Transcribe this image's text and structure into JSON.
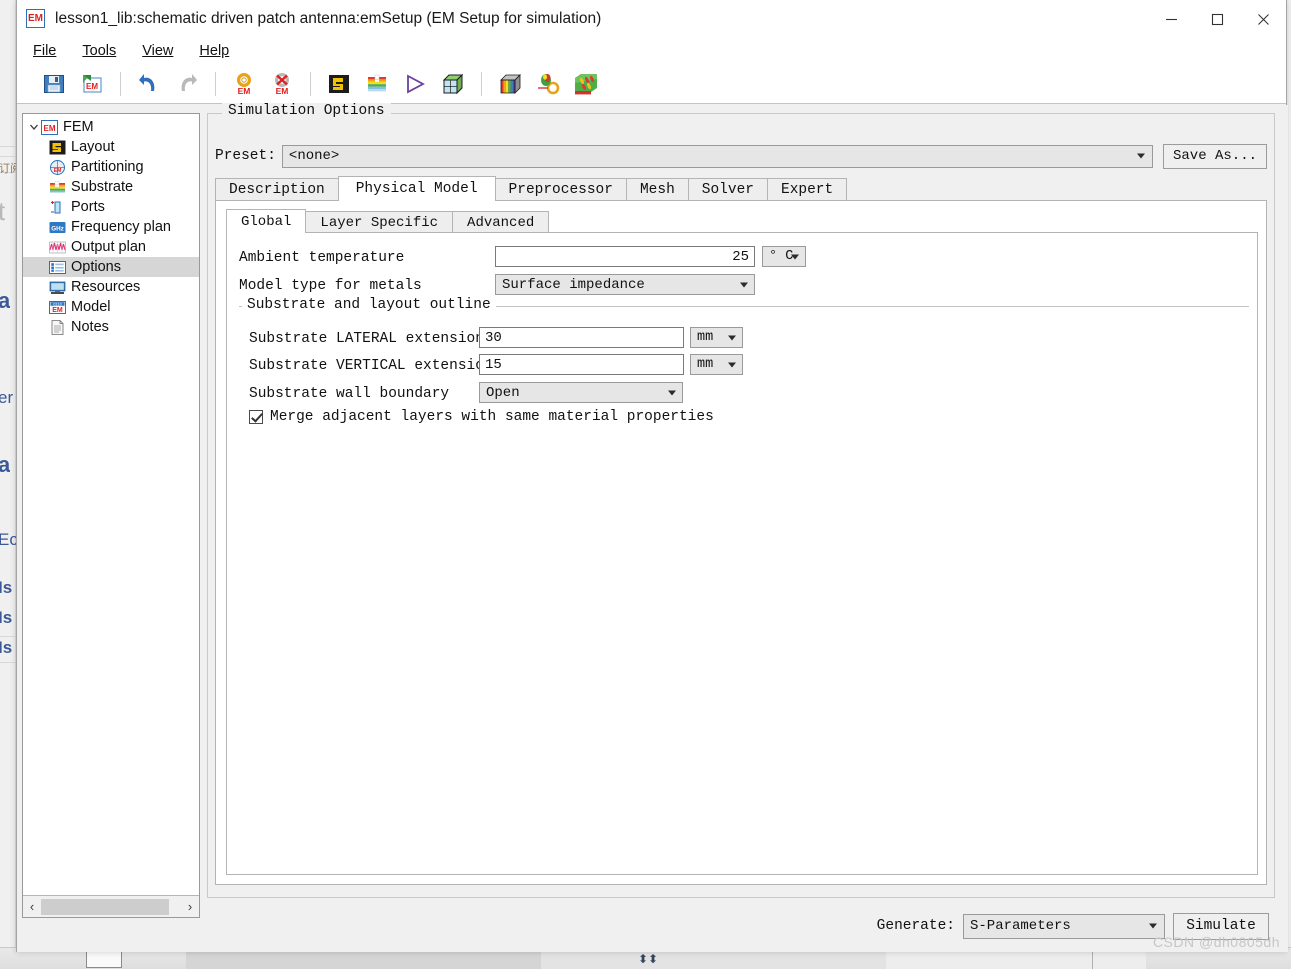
{
  "window": {
    "title": "lesson1_lib:schematic driven patch antenna:emSetup (EM Setup for simulation)",
    "app_icon_text": "EM",
    "minimize_label": "—",
    "maximize_label": "□",
    "close_label": "✕"
  },
  "menubar": {
    "items": [
      {
        "label": "File",
        "accel": "F"
      },
      {
        "label": "Tools",
        "accel": "T"
      },
      {
        "label": "View",
        "accel": "V"
      },
      {
        "label": "Help",
        "accel": "H"
      }
    ]
  },
  "toolbar": {
    "buttons": [
      {
        "name": "save-icon",
        "tooltip": "Save"
      },
      {
        "name": "export-em-icon",
        "tooltip": "Export EM"
      },
      {
        "name": "undo-icon",
        "tooltip": "Undo"
      },
      {
        "name": "redo-icon",
        "tooltip": "Redo"
      },
      {
        "name": "em-setup-icon",
        "tooltip": "EM Setup"
      },
      {
        "name": "em-delete-icon",
        "tooltip": "Delete EM Setup"
      },
      {
        "name": "layout-icon",
        "tooltip": "Layout"
      },
      {
        "name": "substrate-icon",
        "tooltip": "Substrate"
      },
      {
        "name": "simulate-icon",
        "tooltip": "Simulate"
      },
      {
        "name": "mesh-cube-icon",
        "tooltip": "3D Mesh"
      },
      {
        "name": "rainbow-cube-icon",
        "tooltip": "3D View"
      },
      {
        "name": "em-cosim-icon",
        "tooltip": "EM Cosimulation"
      },
      {
        "name": "em-model-icon",
        "tooltip": "EM Model"
      }
    ]
  },
  "tree": {
    "root": {
      "label": "FEM",
      "icon": "em-icon",
      "expanded": true
    },
    "items": [
      {
        "label": "Layout",
        "icon": "layout-icon",
        "selected": false
      },
      {
        "label": "Partitioning",
        "icon": "partitioning-icon",
        "selected": false
      },
      {
        "label": "Substrate",
        "icon": "substrate-icon",
        "selected": false
      },
      {
        "label": "Ports",
        "icon": "ports-icon",
        "selected": false
      },
      {
        "label": "Frequency plan",
        "icon": "ghz-icon",
        "selected": false
      },
      {
        "label": "Output plan",
        "icon": "output-plan-icon",
        "selected": false
      },
      {
        "label": "Options",
        "icon": "options-icon",
        "selected": true
      },
      {
        "label": "Resources",
        "icon": "resources-icon",
        "selected": false
      },
      {
        "label": "Model",
        "icon": "model-icon",
        "selected": false
      },
      {
        "label": "Notes",
        "icon": "notes-icon",
        "selected": false
      }
    ],
    "scroll_left_label": "‹",
    "scroll_right_label": "›"
  },
  "group": {
    "title": "Simulation Options"
  },
  "preset": {
    "label": "Preset:",
    "value": "<none>",
    "save_as_label": "Save As..."
  },
  "tabs": {
    "outer": [
      {
        "label": "Description",
        "active": false
      },
      {
        "label": "Physical Model",
        "active": true
      },
      {
        "label": "Preprocessor",
        "active": false
      },
      {
        "label": "Mesh",
        "active": false
      },
      {
        "label": "Solver",
        "active": false
      },
      {
        "label": "Expert",
        "active": false
      }
    ],
    "inner": [
      {
        "label": "Global",
        "active": true
      },
      {
        "label": "Layer Specific",
        "active": false
      },
      {
        "label": "Advanced",
        "active": false
      }
    ]
  },
  "form": {
    "ambient_temperature": {
      "label": "Ambient temperature",
      "value": "25",
      "unit": "° C"
    },
    "model_type_for_metals": {
      "label": "Model type for metals",
      "value": "Surface impedance"
    },
    "section_title": "Substrate and layout outline",
    "substrate_lateral": {
      "label": "Substrate LATERAL extension",
      "value": "30",
      "unit": "mm"
    },
    "substrate_vertical": {
      "label": "Substrate VERTICAL extension",
      "value": "15",
      "unit": "mm"
    },
    "substrate_wall_boundary": {
      "label": "Substrate wall boundary",
      "value": "Open"
    },
    "merge_layers": {
      "label": "Merge adjacent layers with same material properties",
      "checked": true
    }
  },
  "bottom": {
    "generate_label": "Generate:",
    "generate_value": "S-Parameters",
    "simulate_label": "Simulate"
  },
  "watermark": "CSDN @dh0805dh",
  "colors": {
    "accent_blue": "#2f6fb5",
    "em_red": "#e02020",
    "selection_gray": "#d6d6d6",
    "window_bg": "#f0f0f0"
  }
}
